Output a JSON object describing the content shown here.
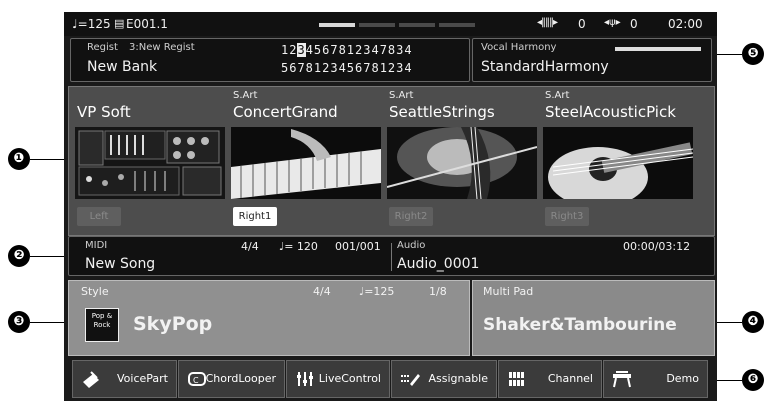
{
  "status_bar": {
    "tempo": "♩=125",
    "measure": "E001.1",
    "vol_left": "0",
    "vol_right": "0",
    "time": "02:00"
  },
  "registration": {
    "label": "Regist",
    "slot": "3:New Regist",
    "bank": "New Bank",
    "row1_pre": "12",
    "row1_hl": "3",
    "row1_post": "4567812347834",
    "row2": "5678123456781234"
  },
  "vocal_harmony": {
    "label": "Vocal Harmony",
    "value": "StandardHarmony"
  },
  "voices": [
    {
      "tag": "",
      "name": "VP Soft",
      "part": "Left",
      "active": false
    },
    {
      "tag": "S.Art",
      "name": "ConcertGrand",
      "part": "Right1",
      "active": true
    },
    {
      "tag": "S.Art",
      "name": "SeattleStrings",
      "part": "Right2",
      "active": false
    },
    {
      "tag": "S.Art",
      "name": "SteelAcousticPick",
      "part": "Right3",
      "active": false
    }
  ],
  "song": {
    "midi_label": "MIDI",
    "midi_name": "New Song",
    "time_sig": "4/4",
    "tempo": "♩= 120",
    "position": "001/001",
    "audio_label": "Audio",
    "audio_name": "Audio_0001",
    "audio_time": "00:00/03:12"
  },
  "style": {
    "label": "Style",
    "time_sig": "4/4",
    "tempo": "♩=125",
    "bar": "1/8",
    "name": "SkyPop",
    "icon_text": "Pop & Rock"
  },
  "multipad": {
    "label": "Multi Pad",
    "name": "Shaker&Tambourine"
  },
  "bottom_buttons": [
    {
      "label": "VoicePart",
      "icon": "keyboard-icon"
    },
    {
      "label": "ChordLooper",
      "icon": "chord-icon"
    },
    {
      "label": "LiveControl",
      "icon": "slider-icon"
    },
    {
      "label": "Assignable",
      "icon": "assign-icon"
    },
    {
      "label": "Channel",
      "icon": "grid-icon"
    },
    {
      "label": "Demo",
      "icon": "demo-icon"
    }
  ],
  "callouts": [
    "❶",
    "❷",
    "❸",
    "❹",
    "❺",
    "❻"
  ]
}
